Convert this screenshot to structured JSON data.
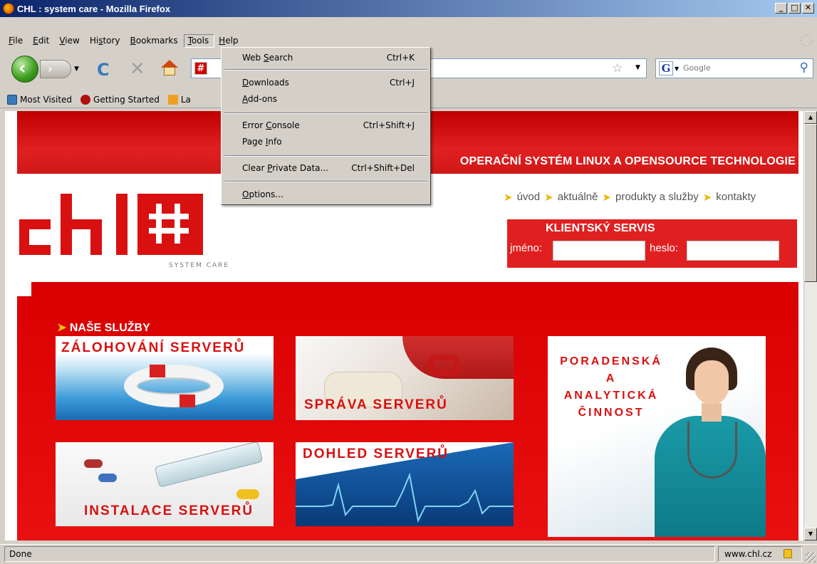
{
  "window": {
    "title": "CHL : system care - Mozilla Firefox",
    "buttons": {
      "minimize": "_",
      "maximize": "□",
      "close": "✕"
    }
  },
  "menubar": {
    "items": [
      {
        "label": "File",
        "ul": "F",
        "rest": "ile"
      },
      {
        "label": "Edit",
        "ul": "E",
        "rest": "dit"
      },
      {
        "label": "View",
        "ul": "V",
        "rest": "iew"
      },
      {
        "label": "History",
        "pre": "Hi",
        "ul": "s",
        "rest": "tory"
      },
      {
        "label": "Bookmarks",
        "ul": "B",
        "rest": "ookmarks"
      },
      {
        "label": "Tools",
        "ul": "T",
        "rest": "ools"
      },
      {
        "label": "Help",
        "ul": "H",
        "rest": "elp"
      }
    ],
    "active": "Tools"
  },
  "toolbar": {
    "back_icon": "back-arrow-icon",
    "forward_icon": "forward-arrow-icon",
    "reload_glyph": "C",
    "stop_glyph": "✕",
    "url_value": "",
    "favicon_glyph": "#",
    "search_placeholder": "Google",
    "search_engine_glyph": "G"
  },
  "bookmarks": [
    {
      "label": "Most Visited",
      "icon": "most-visited-icon"
    },
    {
      "label": "Getting Started",
      "icon": "getting-started-icon"
    },
    {
      "label": "La",
      "icon": "rss-feed-icon"
    }
  ],
  "tools_menu": {
    "items": [
      {
        "label": "Web Search",
        "pre": "Web ",
        "ul": "S",
        "rest": "earch",
        "shortcut": "Ctrl+K"
      },
      {
        "label": "Downloads",
        "pre": "",
        "ul": "D",
        "rest": "ownloads",
        "shortcut": "Ctrl+J"
      },
      {
        "label": "Add-ons",
        "pre": "",
        "ul": "A",
        "rest": "dd-ons",
        "shortcut": ""
      },
      {
        "label": "Error Console",
        "pre": "Error ",
        "ul": "C",
        "rest": "onsole",
        "shortcut": "Ctrl+Shift+J"
      },
      {
        "label": "Page Info",
        "pre": "Page ",
        "ul": "I",
        "rest": "nfo",
        "shortcut": ""
      },
      {
        "label": "Clear Private Data...",
        "pre": "Clear ",
        "ul": "P",
        "rest": "rivate Data...",
        "shortcut": "Ctrl+Shift+Del"
      },
      {
        "label": "Options...",
        "pre": "",
        "ul": "O",
        "rest": "ptions...",
        "shortcut": ""
      }
    ]
  },
  "page": {
    "slogan": "OPERAČNÍ SYSTÉM LINUX A OPENSOURCE TECHNOLOGIE",
    "logo_tagline": "SYSTEM CARE",
    "nav": [
      "úvod",
      "aktuálně",
      "produkty a služby",
      "kontakty"
    ],
    "client_service": {
      "title": "KLIENTSKÝ SERVIS",
      "name_label": "jméno:",
      "password_label": "heslo:",
      "name_value": "",
      "password_value": ""
    },
    "services_heading": "NAŠE SLUŽBY",
    "tiles": {
      "backup": "ZÁLOHOVÁNÍ SERVERŮ",
      "admin": "SPRÁVA SERVERŮ",
      "consulting": [
        "PORADENSKÁ",
        "A",
        "ANALYTICKÁ",
        "ČINNOST"
      ],
      "install": "INSTALACE SERVERŮ",
      "monitor": "DOHLED SERVERŮ"
    }
  },
  "status": {
    "text": "Done",
    "domain": "www.chl.cz"
  },
  "colors": {
    "brand_red": "#d81010",
    "accent_yellow": "#e8b800",
    "titlebar_blue": "#0a246a"
  }
}
